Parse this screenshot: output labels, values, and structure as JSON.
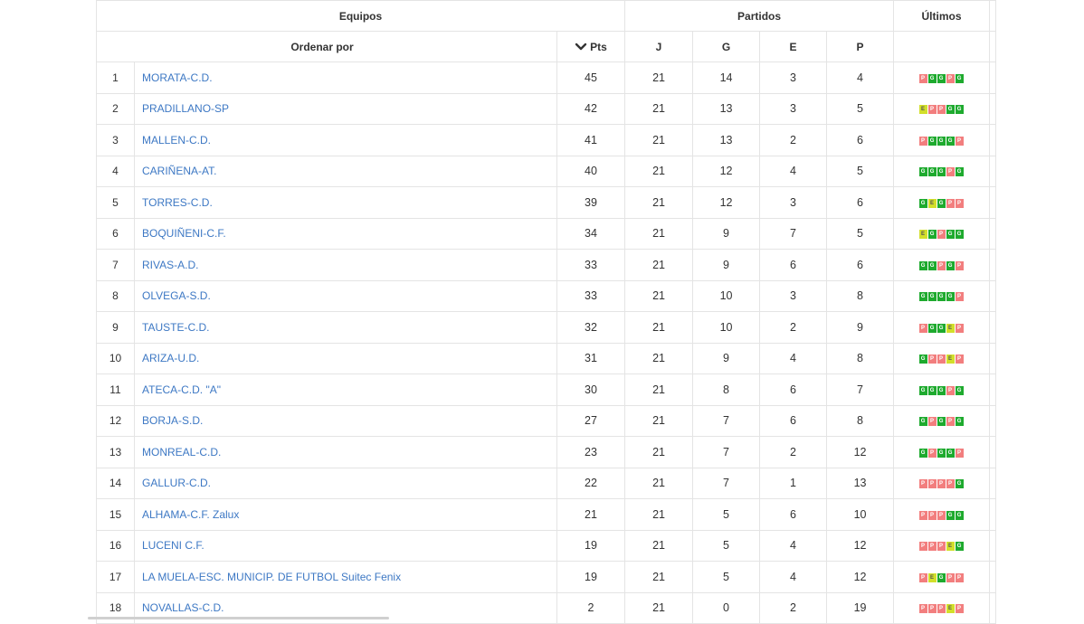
{
  "header": {
    "group_teams": "Equipos",
    "group_matches": "Partidos",
    "group_last": "Últimos",
    "sort_label": "Ordenar por",
    "col_pts": "Pts",
    "col_j": "J",
    "col_g": "G",
    "col_e": "E",
    "col_p": "P"
  },
  "colors": {
    "team_link": "#3d78c4",
    "form_win": "#1eaa2e",
    "form_draw": "#d2df2a",
    "form_loss": "#f27e7e"
  },
  "rows": [
    {
      "pos": "1",
      "team": "MORATA-C.D.",
      "pts": "45",
      "j": "21",
      "g": "14",
      "e": "3",
      "p": "4",
      "form": [
        "P",
        "G",
        "G",
        "P",
        "G"
      ]
    },
    {
      "pos": "2",
      "team": "PRADILLANO-SP",
      "pts": "42",
      "j": "21",
      "g": "13",
      "e": "3",
      "p": "5",
      "form": [
        "E",
        "P",
        "P",
        "G",
        "G"
      ]
    },
    {
      "pos": "3",
      "team": "MALLEN-C.D.",
      "pts": "41",
      "j": "21",
      "g": "13",
      "e": "2",
      "p": "6",
      "form": [
        "P",
        "G",
        "G",
        "G",
        "P"
      ]
    },
    {
      "pos": "4",
      "team": "CARIÑENA-AT.",
      "pts": "40",
      "j": "21",
      "g": "12",
      "e": "4",
      "p": "5",
      "form": [
        "G",
        "G",
        "G",
        "P",
        "G"
      ]
    },
    {
      "pos": "5",
      "team": "TORRES-C.D.",
      "pts": "39",
      "j": "21",
      "g": "12",
      "e": "3",
      "p": "6",
      "form": [
        "G",
        "E",
        "G",
        "P",
        "P"
      ]
    },
    {
      "pos": "6",
      "team": "BOQUIÑENI-C.F.",
      "pts": "34",
      "j": "21",
      "g": "9",
      "e": "7",
      "p": "5",
      "form": [
        "E",
        "G",
        "P",
        "G",
        "G"
      ]
    },
    {
      "pos": "7",
      "team": "RIVAS-A.D.",
      "pts": "33",
      "j": "21",
      "g": "9",
      "e": "6",
      "p": "6",
      "form": [
        "G",
        "G",
        "P",
        "G",
        "P"
      ]
    },
    {
      "pos": "8",
      "team": "OLVEGA-S.D.",
      "pts": "33",
      "j": "21",
      "g": "10",
      "e": "3",
      "p": "8",
      "form": [
        "G",
        "G",
        "G",
        "G",
        "P"
      ]
    },
    {
      "pos": "9",
      "team": "TAUSTE-C.D.",
      "pts": "32",
      "j": "21",
      "g": "10",
      "e": "2",
      "p": "9",
      "form": [
        "P",
        "G",
        "G",
        "E",
        "P"
      ]
    },
    {
      "pos": "10",
      "team": "ARIZA-U.D.",
      "pts": "31",
      "j": "21",
      "g": "9",
      "e": "4",
      "p": "8",
      "form": [
        "G",
        "P",
        "P",
        "E",
        "P"
      ]
    },
    {
      "pos": "11",
      "team": "ATECA-C.D. \"A\"",
      "pts": "30",
      "j": "21",
      "g": "8",
      "e": "6",
      "p": "7",
      "form": [
        "G",
        "G",
        "G",
        "P",
        "G"
      ]
    },
    {
      "pos": "12",
      "team": "BORJA-S.D.",
      "pts": "27",
      "j": "21",
      "g": "7",
      "e": "6",
      "p": "8",
      "form": [
        "G",
        "P",
        "G",
        "P",
        "G"
      ]
    },
    {
      "pos": "13",
      "team": "MONREAL-C.D.",
      "pts": "23",
      "j": "21",
      "g": "7",
      "e": "2",
      "p": "12",
      "form": [
        "G",
        "P",
        "G",
        "G",
        "P"
      ]
    },
    {
      "pos": "14",
      "team": "GALLUR-C.D.",
      "pts": "22",
      "j": "21",
      "g": "7",
      "e": "1",
      "p": "13",
      "form": [
        "P",
        "P",
        "P",
        "P",
        "G"
      ]
    },
    {
      "pos": "15",
      "team": "ALHAMA-C.F. Zalux",
      "pts": "21",
      "j": "21",
      "g": "5",
      "e": "6",
      "p": "10",
      "form": [
        "P",
        "P",
        "P",
        "G",
        "G"
      ]
    },
    {
      "pos": "16",
      "team": "LUCENI C.F.",
      "pts": "19",
      "j": "21",
      "g": "5",
      "e": "4",
      "p": "12",
      "form": [
        "P",
        "P",
        "P",
        "E",
        "G"
      ]
    },
    {
      "pos": "17",
      "team": "LA MUELA-ESC. MUNICIP. DE FUTBOL Suitec Fenix",
      "pts": "19",
      "j": "21",
      "g": "5",
      "e": "4",
      "p": "12",
      "form": [
        "P",
        "E",
        "G",
        "P",
        "P"
      ]
    },
    {
      "pos": "18",
      "team": "NOVALLAS-C.D.",
      "pts": "2",
      "j": "21",
      "g": "0",
      "e": "2",
      "p": "19",
      "form": [
        "P",
        "P",
        "P",
        "E",
        "P"
      ]
    }
  ]
}
